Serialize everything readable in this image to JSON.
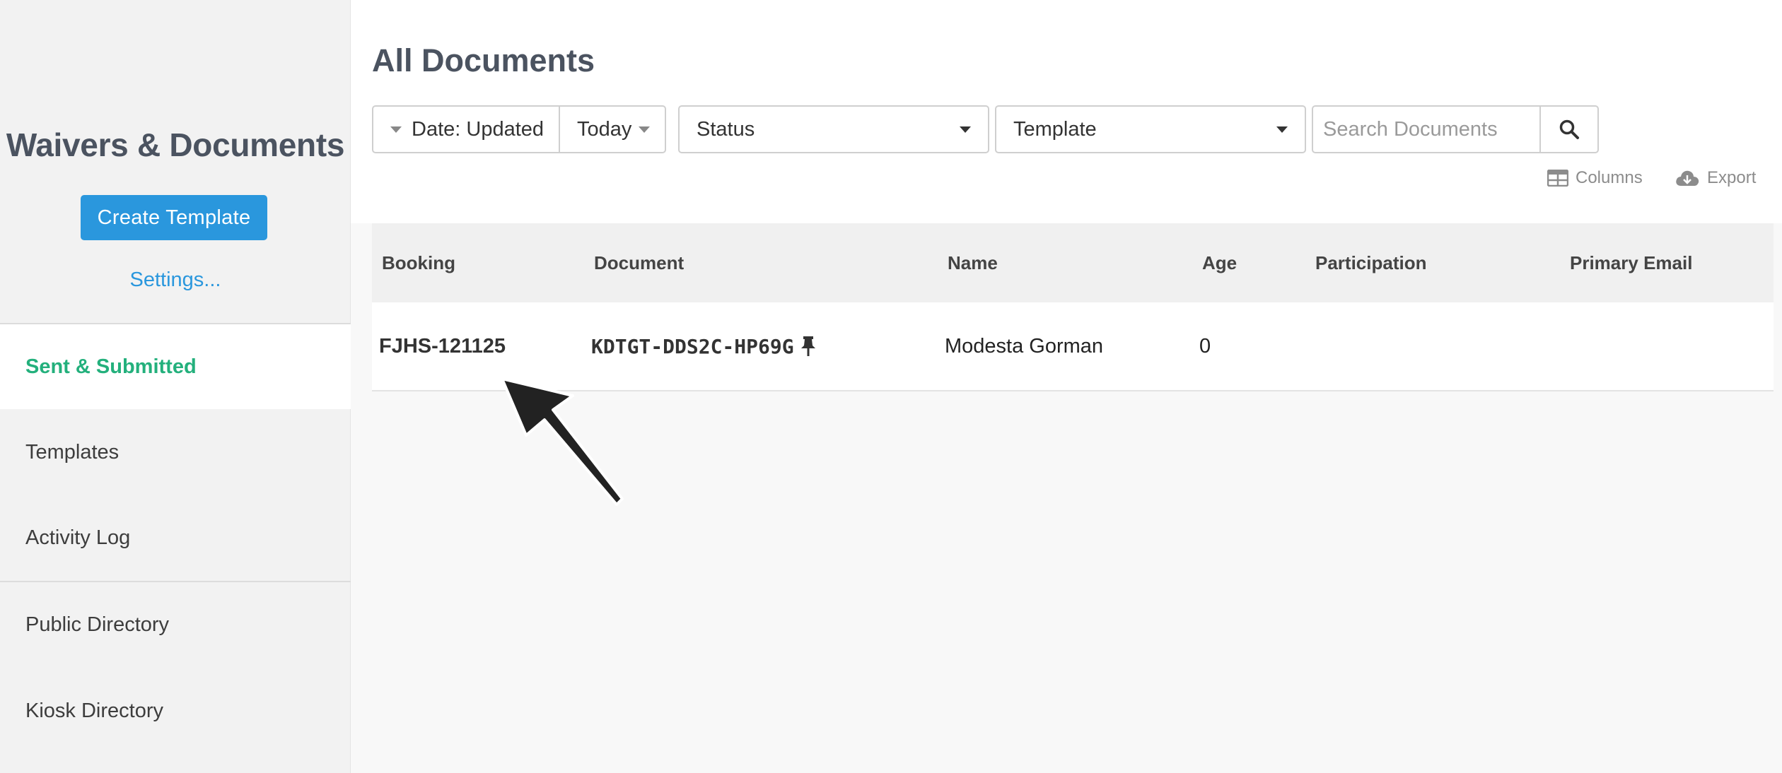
{
  "sidebar": {
    "title": "Waivers & Documents",
    "create_button": "Create Template",
    "settings_link": "Settings...",
    "items": [
      {
        "label": "Sent & Submitted",
        "active": true
      },
      {
        "label": "Templates"
      },
      {
        "label": "Activity Log"
      },
      {
        "label": "Public Directory"
      },
      {
        "label": "Kiosk Directory"
      }
    ]
  },
  "main": {
    "title": "All Documents",
    "filters": {
      "date_field": "Date: Updated",
      "date_range": "Today",
      "status": "Status",
      "template": "Template",
      "search_placeholder": "Search Documents"
    },
    "toolbar": {
      "columns": "Columns",
      "export": "Export"
    },
    "table": {
      "columns": [
        "Booking",
        "Document",
        "Name",
        "Age",
        "Participation",
        "Primary Email"
      ],
      "rows": [
        {
          "booking": "FJHS-121125",
          "document": "KDTGT-DDS2C-HP69G",
          "name": "Modesta Gorman",
          "age": "0",
          "participation": "",
          "primary_email": ""
        }
      ]
    }
  },
  "colors": {
    "accent": "#2a97dd",
    "active_nav": "#23b07c"
  }
}
